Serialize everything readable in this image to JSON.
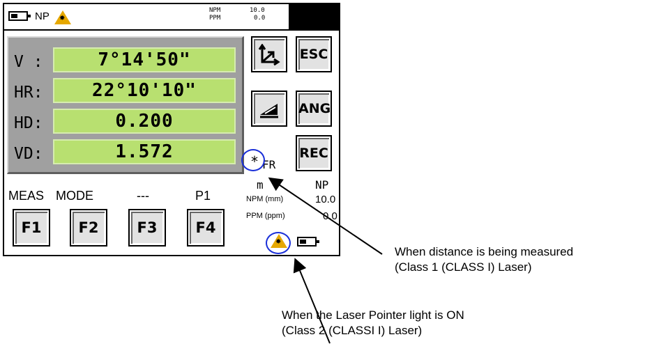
{
  "topbar": {
    "mode_label": "NP",
    "npm_label": "NPM",
    "npm_value": "10.0",
    "ppm_label": "PPM",
    "ppm_value": "0.0"
  },
  "measurements": [
    {
      "label": "V :",
      "value": "7°14'50\""
    },
    {
      "label": "HR:",
      "value": "22°10'10\""
    },
    {
      "label": "HD:",
      "value": "0.200"
    },
    {
      "label": "VD:",
      "value": "1.572"
    }
  ],
  "side_buttons": {
    "esc": "ESC",
    "ang": "ANG",
    "rec": "REC"
  },
  "status": {
    "measuring_indicator": "*",
    "fr_label": "FR",
    "unit": "m",
    "np_label": "NP",
    "npm_label": "NPM (mm)",
    "npm_value": "10.0",
    "ppm_label": "PPM (ppm)",
    "ppm_value": "0.0"
  },
  "function_keys": {
    "labels": [
      "MEAS",
      "MODE",
      "---",
      "P1"
    ],
    "buttons": [
      "F1",
      "F2",
      "F3",
      "F4"
    ]
  },
  "annotations": {
    "distance_line1": "When distance is being measured",
    "distance_line2": "(Class 1 (CLASS I) Laser)",
    "pointer_line1": "When the Laser Pointer light is ON",
    "pointer_line2": "(Class 2 (CLASSI I) Laser)"
  },
  "colors": {
    "field_green": "#b8e070",
    "highlight_circle": "#1a2fd8",
    "laser_warning": "#e6a800"
  }
}
